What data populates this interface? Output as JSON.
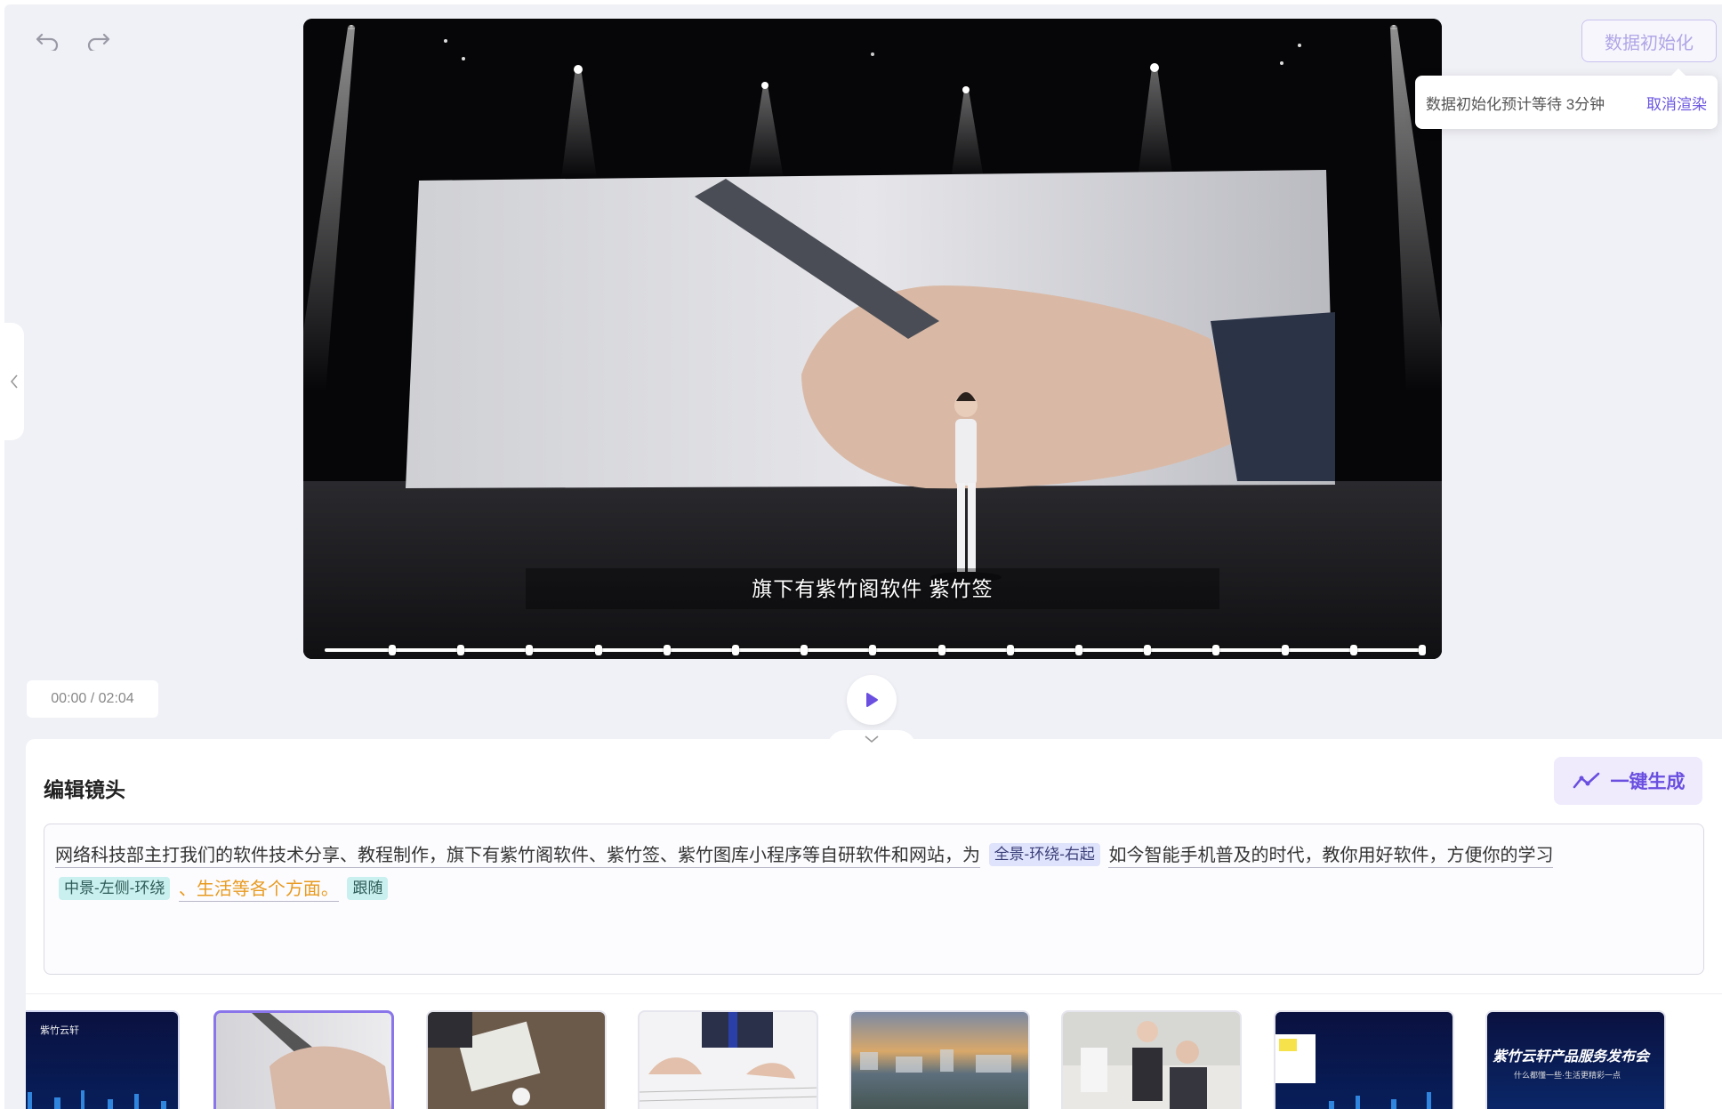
{
  "toolbar": {
    "undo_icon": "undo-icon",
    "redo_icon": "redo-icon"
  },
  "video": {
    "subtitle": "旗下有紫竹阁软件 紫竹签",
    "progress_markers": 16
  },
  "init": {
    "button_label": "数据初始化",
    "popover_message": "数据初始化预计等待 3分钟",
    "cancel_label": "取消渲染"
  },
  "player": {
    "time": "00:00 / 02:04"
  },
  "editor": {
    "title": "编辑镜头",
    "generate_label": "一键生成",
    "script": {
      "line1_text": "网络科技部主打我们的软件技术分享、教程制作，旗下有紫竹阁软件、紫竹签、紫竹图库小程序等自研软件和网站，为",
      "tag1": "全景-环绕-右起",
      "line1_tail": "如今智能手机普及的时代，教你用好软件，方便你的学习",
      "tag2": "中景-左侧-环绕",
      "orange_text": "、生活等各个方面。",
      "tag3": "跟随"
    }
  },
  "thumbnails": [
    {
      "brand": "紫竹云轩"
    },
    {},
    {},
    {},
    {},
    {},
    {},
    {
      "title": "紫竹云轩产品服务发布会",
      "subtitle": "什么都懂一些·生活更精彩一点"
    }
  ],
  "colors": {
    "accent": "#6a4fe0",
    "tag_blue": "#dfe3fb",
    "tag_cyan": "#c9f0ee",
    "orange": "#e89a1f"
  }
}
